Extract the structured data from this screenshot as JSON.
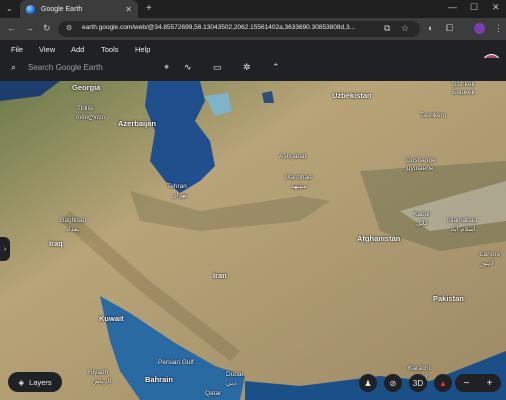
{
  "browser": {
    "tab_title": "Google Earth",
    "url": "earth.google.com/web/@34.85572699,56.13043502,2062.15561402a,3633690.30853808d,3..."
  },
  "menu": {
    "file": "File",
    "view": "View",
    "add": "Add",
    "tools": "Tools",
    "help": "Help"
  },
  "search": {
    "placeholder": "Search Google Earth"
  },
  "map_labels": {
    "georgia": "Georgia",
    "tbilisi": "Tbilisi",
    "tbilisi_native": "თბილისი",
    "azerbaijan": "Azerbaijan",
    "uzbekistan": "Uzbekistan",
    "bishkek": "Bishkek",
    "bishkek_native": "Бишкек",
    "tashkent": "Tashkent",
    "ashgabat": "Ashgabat",
    "dushanbe": "Dushanbe",
    "dushanbe_native": "Душанбе",
    "mashhad": "Mashhad",
    "mashhad_native": "مشهد",
    "tehran": "Tehran",
    "tehran_native": "تهران",
    "baghdad": "Baghdad",
    "baghdad_native": "بغداد",
    "kabul": "Kabul",
    "kabul_native": "کابل",
    "islamabad": "Islamabad",
    "islamabad_native": "اسلام آباد",
    "iraq": "Iraq",
    "afghanistan": "Afghanistan",
    "iran": "Iran",
    "lahore": "Lahore",
    "lahore_native": "لاہور",
    "pakistan": "Pakistan",
    "kuwait": "Kuwait",
    "persian_gulf": "Persian Gulf",
    "riyadh": "Riyadh",
    "riyadh_native": "الرياض",
    "bahrain": "Bahrain",
    "dubai": "Dubai",
    "dubai_native": "دبي",
    "qatar": "Qatar",
    "karachi": "Karachi",
    "karachi_native": "کراچی"
  },
  "controls": {
    "layers": "Layers",
    "three_d": "3D",
    "zoom_out": "−",
    "zoom_in": "+"
  }
}
